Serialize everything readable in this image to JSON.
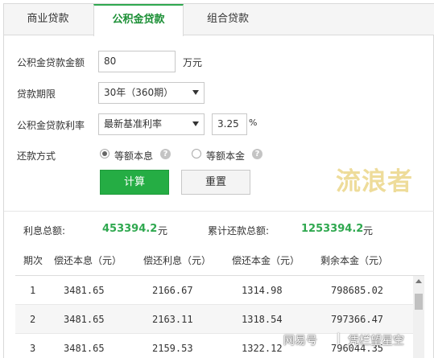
{
  "tabs": [
    {
      "label": "商业贷款",
      "active": false
    },
    {
      "label": "公积金贷款",
      "active": true
    },
    {
      "label": "组合贷款",
      "active": false
    }
  ],
  "form": {
    "amount": {
      "label": "公积金贷款金额",
      "value": "80",
      "unit": "万元"
    },
    "term": {
      "label": "贷款期限",
      "selected": "30年（360期）"
    },
    "rate": {
      "label": "公积金贷款利率",
      "selected": "最新基准利率",
      "value": "3.25",
      "unit": "%"
    },
    "repay": {
      "label": "还款方式",
      "options": [
        {
          "label": "等额本息",
          "checked": true
        },
        {
          "label": "等额本金",
          "checked": false
        }
      ]
    }
  },
  "buttons": {
    "calculate": "计算",
    "reset": "重置"
  },
  "watermark": "流浪者",
  "summary": {
    "interest_label": "利息总额:",
    "interest_value": "453394.2",
    "interest_unit": "元",
    "total_label": "累计还款总额:",
    "total_value": "1253394.2",
    "total_unit": "元"
  },
  "table": {
    "headers": [
      "期次",
      "偿还本息（元）",
      "偿还利息（元）",
      "偿还本金（元）",
      "剩余本金（元）"
    ],
    "rows": [
      [
        "1",
        "3481.65",
        "2166.67",
        "1314.98",
        "798685.02"
      ],
      [
        "2",
        "3481.65",
        "2163.11",
        "1318.54",
        "797366.47"
      ],
      [
        "3",
        "3481.65",
        "2159.53",
        "1322.12",
        "796044.35"
      ]
    ]
  },
  "footer": {
    "source": "网易号",
    "separator": "|",
    "author": "凭栏望星空"
  },
  "colors": {
    "accent": "#2fa84f",
    "button": "#25ad44",
    "watermark": "#eedc9a"
  }
}
